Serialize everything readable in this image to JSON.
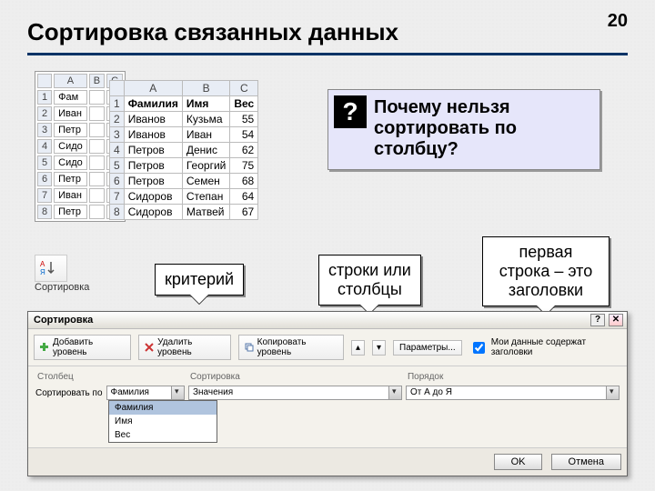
{
  "page_number": "20",
  "title": "Сортировка связанных данных",
  "small_table": {
    "cols": [
      "",
      "A",
      "B",
      "C"
    ],
    "rows": [
      "1",
      "2",
      "3",
      "4",
      "5",
      "6",
      "7",
      "8"
    ],
    "first_col_label": "Фам",
    "partial": [
      "Иван",
      "Петр",
      "Сидо",
      "Сидо",
      "Петр",
      "Иван",
      "Петр"
    ]
  },
  "data_table": {
    "cols": [
      "",
      "A",
      "B",
      "C"
    ],
    "headers": [
      "Фамилия",
      "Имя",
      "Вес"
    ],
    "rows": [
      [
        "1",
        "Фамилия",
        "Имя",
        "Вес"
      ],
      [
        "2",
        "Иванов",
        "Кузьма",
        "55"
      ],
      [
        "3",
        "Иванов",
        "Иван",
        "54"
      ],
      [
        "4",
        "Петров",
        "Денис",
        "62"
      ],
      [
        "5",
        "Петров",
        "Георгий",
        "75"
      ],
      [
        "6",
        "Петров",
        "Семен",
        "68"
      ],
      [
        "7",
        "Сидоров",
        "Степан",
        "64"
      ],
      [
        "8",
        "Сидоров",
        "Матвей",
        "67"
      ]
    ]
  },
  "sort_icon_label": "Сортировка",
  "question": {
    "mark": "?",
    "text": "Почему нельзя сортировать по столбцу?"
  },
  "callouts": {
    "criterion": "критерий",
    "rows_or_cols": "строки или\nстолбцы",
    "first_row": "первая строка – это заголовки"
  },
  "dialog": {
    "title": "Сортировка",
    "add_level": "Добавить уровень",
    "del_level": "Удалить уровень",
    "copy_level": "Копировать уровень",
    "params": "Параметры...",
    "headers_chk": "Мои данные содержат заголовки",
    "col_header": "Столбец",
    "sort_header": "Сортировка",
    "order_header": "Порядок",
    "sort_by_label": "Сортировать по",
    "sort_by_value": "Фамилия",
    "sort_on_value": "Значения",
    "order_value": "От А до Я",
    "dropdown": [
      "Фамилия",
      "Имя",
      "Вес"
    ],
    "ok": "OK",
    "cancel": "Отмена"
  }
}
